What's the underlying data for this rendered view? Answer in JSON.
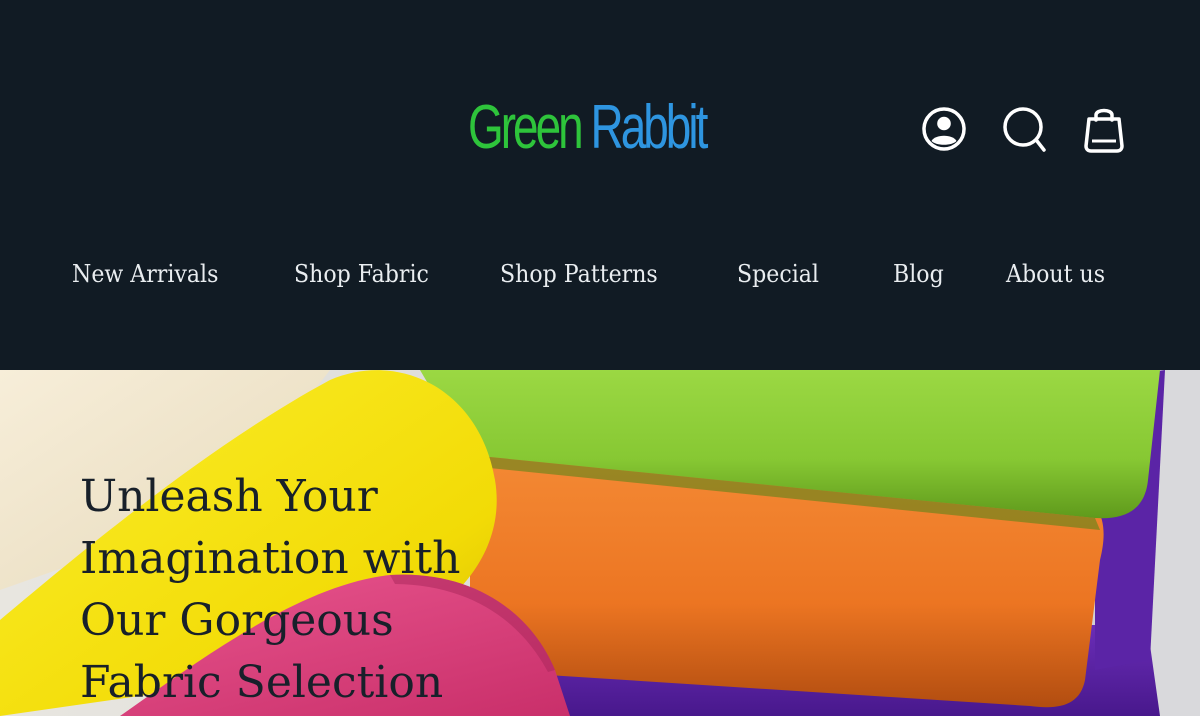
{
  "brand": {
    "word1": "Green",
    "word2": "Rabbit",
    "word1_color": "#2ec43b",
    "word2_color": "#2e95e0"
  },
  "header_icons": [
    {
      "name": "account-icon"
    },
    {
      "name": "search-icon"
    },
    {
      "name": "shopping-bag-icon"
    }
  ],
  "nav": {
    "items": [
      {
        "label": "New Arrivals"
      },
      {
        "label": "Shop Fabric"
      },
      {
        "label": "Shop Patterns"
      },
      {
        "label": "Special"
      },
      {
        "label": "Blog"
      },
      {
        "label": "About us"
      }
    ]
  },
  "hero": {
    "title_lines": [
      "Unleash Your",
      "Imagination with",
      "Our Gorgeous",
      "Fabric Selection"
    ]
  },
  "colors": {
    "header_bg": "#111b24",
    "nav_text": "#e9edf0",
    "hero_text": "#18202a",
    "fabric_cream": "#f1e6cd",
    "fabric_yellow": "#f6e20a",
    "fabric_pink": "#e4407f",
    "fabric_green": "#8fd23a",
    "fabric_orange": "#ef7a28",
    "fabric_purple": "#5b24a6"
  }
}
